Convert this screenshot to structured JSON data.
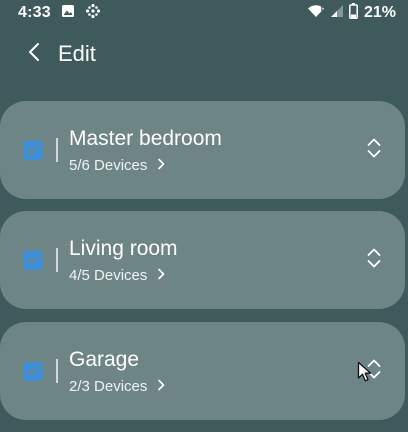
{
  "status_bar": {
    "time": "4:33",
    "battery_percent": "21%",
    "icons": [
      "image-icon",
      "grid-dots-icon",
      "wifi-icon",
      "signal-icon",
      "battery-icon"
    ]
  },
  "header": {
    "back_icon": "chevron-left-icon",
    "title": "Edit"
  },
  "rooms": [
    {
      "name": "Master bedroom",
      "devices": "5/6 Devices",
      "checked": true
    },
    {
      "name": "Living room",
      "devices": "4/5 Devices",
      "checked": true
    },
    {
      "name": "Garage",
      "devices": "2/3 Devices",
      "checked": true
    }
  ],
  "colors": {
    "background": "#3f5a5b",
    "card": "#6e8585",
    "checkbox": "#3d8ed8"
  }
}
